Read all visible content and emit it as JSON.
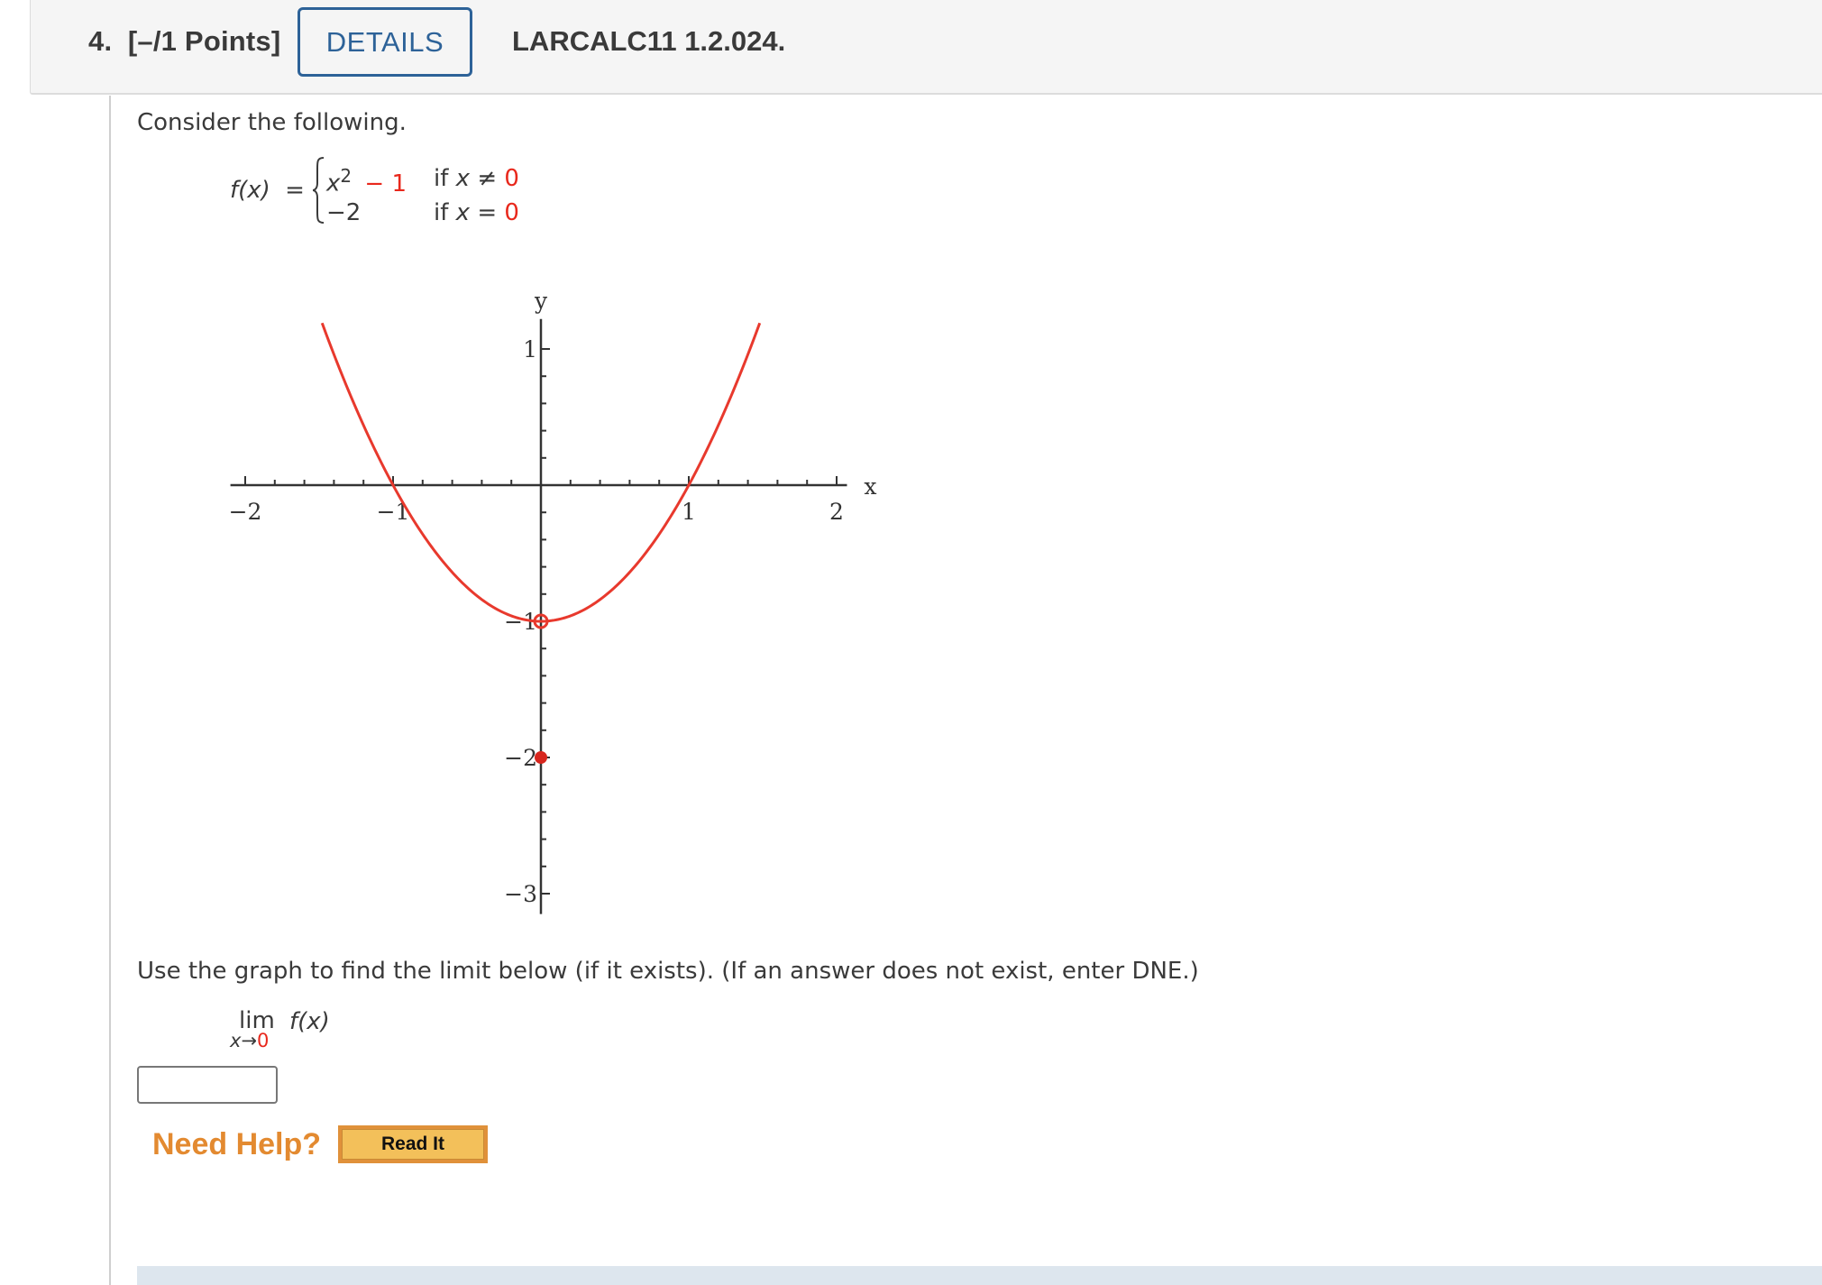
{
  "header": {
    "question_number": "4.",
    "points": "[–/1 Points]",
    "details_label": "DETAILS",
    "question_code": "LARCALC11 1.2.024."
  },
  "prompt": {
    "intro": "Consider the following.",
    "function": {
      "lhs": "f(x)",
      "equals": "=",
      "case1_expr_base": "x",
      "case1_expr_exp": "2",
      "case1_expr_rest": "− 1",
      "case1_cond_prefix": "if",
      "case1_cond_var": "x",
      "case1_cond_op": "≠",
      "case1_cond_val": "0",
      "case2_expr": "−2",
      "case2_cond_prefix": "if",
      "case2_cond_var": "x",
      "case2_cond_op": "=",
      "case2_cond_val": "0"
    },
    "instruction": "Use the graph to find the limit below (if it exists). (If an answer does not exist, enter DNE.)",
    "limit": {
      "lim": "lim",
      "sub_var": "x",
      "sub_arrow": "→",
      "sub_val": "0",
      "expr": "f(x)"
    }
  },
  "answer": {
    "value": "",
    "placeholder": ""
  },
  "help": {
    "need_help_label": "Need Help?",
    "read_it_label": "Read It"
  },
  "colors": {
    "accent_blue": "#2d6298",
    "curve_red": "#e8392d",
    "help_orange": "#e38a30",
    "button_fill": "#f3c05a"
  },
  "chart_data": {
    "type": "line",
    "title": "",
    "xlabel": "x",
    "ylabel": "y",
    "xlim": [
      -2.1,
      2.07
    ],
    "ylim": [
      -3.15,
      1.22
    ],
    "x_ticks": [
      -2,
      -1,
      1,
      2
    ],
    "x_tick_labels": [
      "−2",
      "−1",
      "1",
      "2"
    ],
    "x_minor_step": 0.2,
    "y_ticks": [
      1,
      -1,
      -2,
      -3
    ],
    "y_tick_labels": [
      "1",
      "−1",
      "−2",
      "−3"
    ],
    "y_minor_step": 0.2,
    "grid": false,
    "series": [
      {
        "name": "f(x) = x^2 - 1",
        "function": "x^2-1",
        "x_range": [
          -1.48,
          1.48
        ]
      }
    ],
    "points": [
      {
        "name": "open-circle",
        "x": 0,
        "y": -1,
        "filled": false
      },
      {
        "name": "closed-dot",
        "x": 0,
        "y": -2,
        "filled": true
      }
    ]
  }
}
